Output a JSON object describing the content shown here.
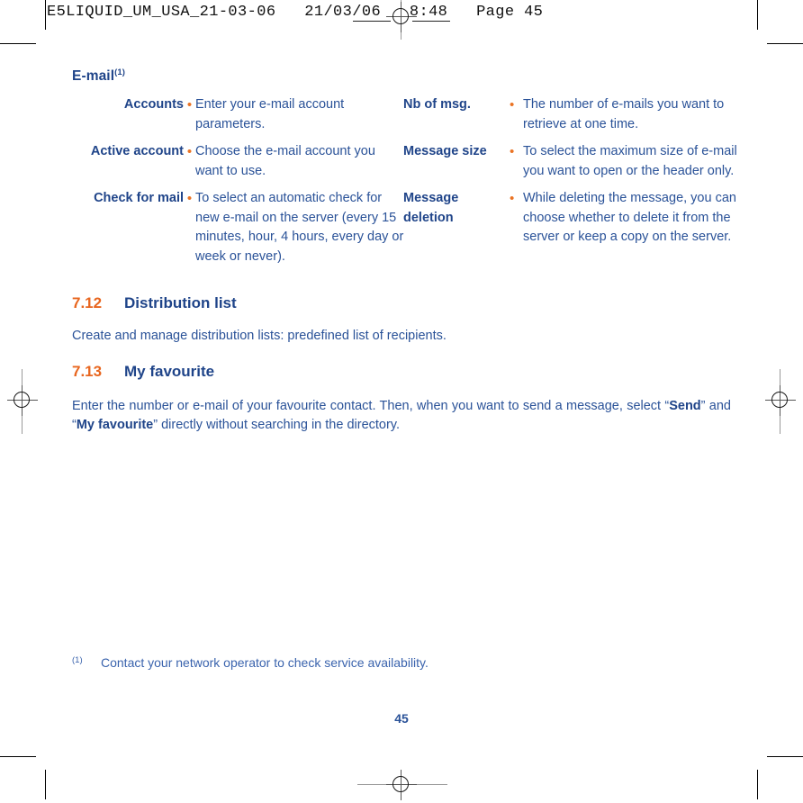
{
  "header": {
    "text": "E5LIQUID_UM_USA_21-03-06   21/03/06   8:48   Page 45"
  },
  "content": {
    "subsection_title": "E-mail",
    "subsection_footnote_marker": "(1)",
    "definitions_left": [
      {
        "label": "Accounts",
        "bullet": "•",
        "description": "Enter your e-mail account parameters."
      },
      {
        "label": "Active account",
        "bullet": "•",
        "description": "Choose the e-mail account you want to use."
      },
      {
        "label": "Check for mail",
        "bullet": "•",
        "description": "To select an automatic check for new e-mail on the server (every 15 minutes, hour, 4 hours, every day or week or never)."
      }
    ],
    "definitions_right": [
      {
        "label": "Nb of msg.",
        "bullet": "•",
        "description": "The number of e-mails you want to retrieve at one time."
      },
      {
        "label": "Message size",
        "bullet": "•",
        "description": "To select the maximum size of e-mail you want to open or the header only."
      },
      {
        "label": "Message deletion",
        "bullet": "•",
        "description": "While deleting the message, you can choose whether to delete it from the server or keep a copy on the server."
      }
    ],
    "sections": [
      {
        "number": "7.12",
        "title": "Distribution list",
        "body_plain": "Create and manage distribution lists: predefined list of recipients."
      },
      {
        "number": "7.13",
        "title": "My favourite",
        "body_part1": "Enter the number or e-mail of your favourite contact. Then, when you want to send a message, select “",
        "body_bold1": "Send",
        "body_part2": "” and “",
        "body_bold2": "My favourite",
        "body_part3": "” directly without searching in the directory."
      }
    ],
    "footnote": {
      "marker": "(1)",
      "text": "Contact your network operator to check service availability."
    },
    "page_number": "45"
  },
  "colors": {
    "heading_blue": "#1f4489",
    "body_blue": "#2a5298",
    "accent_orange": "#e8661f",
    "bullet_orange": "#ea7324",
    "footnote_blue": "#3a63ad"
  }
}
